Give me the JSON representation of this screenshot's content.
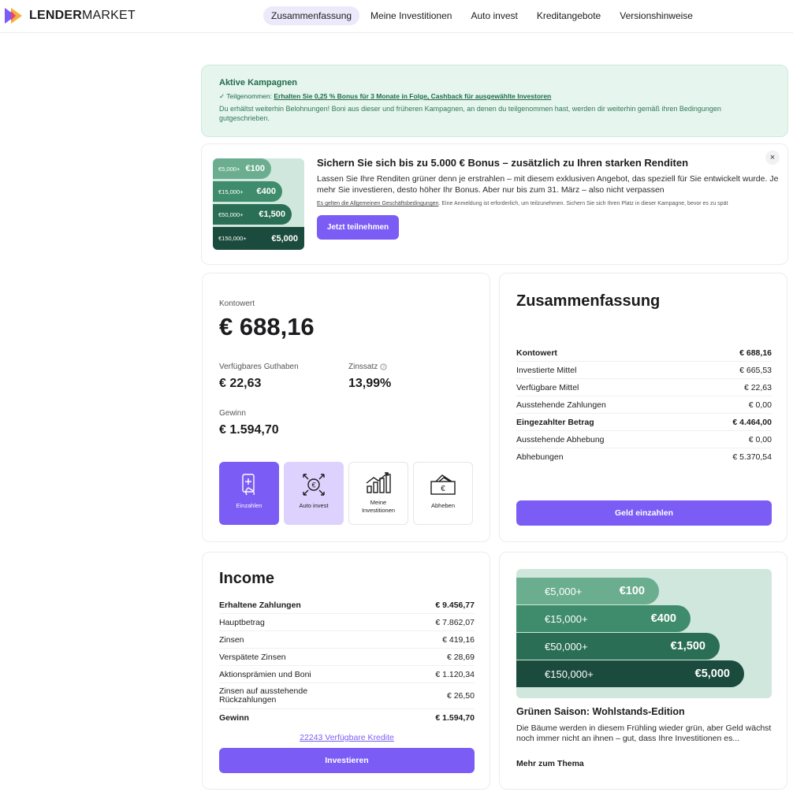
{
  "header": {
    "logo_bold": "LENDER",
    "logo_light": "MARKET",
    "nav": [
      "Zusammenfassung",
      "Meine Investitionen",
      "Auto invest",
      "Kreditangebote",
      "Versionshinweise"
    ]
  },
  "campaign": {
    "title": "Aktive Kampagnen",
    "joined_prefix": "✓ Teilgenommen: ",
    "joined_link": "Erhalten Sie 0,25 % Bonus für 3 Monate in Folge, Cashback für ausgewählte Investoren",
    "text": "Du erhältst weiterhin Belohnungen! Boni aus dieser und früheren Kampagnen, an denen du teilgenommen hast, werden dir weiterhin gemäß ihren Bedingungen gutgeschrieben."
  },
  "promo": {
    "tiers": [
      {
        "min": "€5,000+",
        "bonus": "€100"
      },
      {
        "min": "€15,000+",
        "bonus": "€400"
      },
      {
        "min": "€50,000+",
        "bonus": "€1,500"
      },
      {
        "min": "€150,000+",
        "bonus": "€5,000"
      }
    ],
    "title": "Sichern Sie sich bis zu 5.000 € Bonus – zusätzlich zu Ihren starken Renditen",
    "description": "Lassen Sie Ihre Renditen grüner denn je erstrahlen – mit diesem exklusiven Angebot, das speziell für Sie entwickelt wurde. Je mehr Sie investieren, desto höher Ihr Bonus. Aber nur bis zum 31. März – also nicht verpassen",
    "terms_link": "Es gelten die Allgemeinen Geschäftsbedingungen",
    "terms_rest": ". Eine Anmeldung ist erforderlich, um teilzunehmen. Sichern Sie sich Ihren Platz in dieser Kampagne, bevor es zu spät",
    "button": "Jetzt teilnehmen",
    "close": "×"
  },
  "account": {
    "value_label": "Kontowert",
    "value": "€ 688,16",
    "available_label": "Verfügbares Guthaben",
    "available": "€ 22,63",
    "interest_label": "Zinssatz",
    "interest": "13,99%",
    "profit_label": "Gewinn",
    "profit": "€ 1.594,70",
    "actions": [
      {
        "label": "Einzahlen",
        "icon": "deposit-phone-icon"
      },
      {
        "label": "Auto invest",
        "icon": "auto-invest-icon"
      },
      {
        "label": "Meine Investitionen",
        "icon": "investment-chart-icon"
      },
      {
        "label": "Abheben",
        "icon": "withdraw-cash-icon"
      }
    ]
  },
  "summary": {
    "title": "Zusammenfassung",
    "rows": [
      {
        "label": "Kontowert",
        "value": "€ 688,16",
        "bold": true
      },
      {
        "label": "Investierte Mittel",
        "value": "€ 665,53",
        "bold": false
      },
      {
        "label": "Verfügbare Mittel",
        "value": "€ 22,63",
        "bold": false
      },
      {
        "label": "Ausstehende Zahlungen",
        "value": "€ 0,00",
        "bold": false
      },
      {
        "label": "Eingezahlter Betrag",
        "value": "€ 4.464,00",
        "bold": true
      },
      {
        "label": "Ausstehende Abhebung",
        "value": "€ 0,00",
        "bold": false
      },
      {
        "label": "Abhebungen",
        "value": "€ 5.370,54",
        "bold": false
      }
    ],
    "button": "Geld einzahlen"
  },
  "income": {
    "title": "Income",
    "rows": [
      {
        "label": "Erhaltene Zahlungen",
        "value": "€ 9.456,77",
        "bold": true
      },
      {
        "label": "Hauptbetrag",
        "value": "€ 7.862,07",
        "bold": false
      },
      {
        "label": "Zinsen",
        "value": "€ 419,16",
        "bold": false
      },
      {
        "label": "Verspätete Zinsen",
        "value": "€ 28,69",
        "bold": false
      },
      {
        "label": "Aktionsprämien und Boni",
        "value": "€ 1.120,34",
        "bold": false
      },
      {
        "label": "Zinsen auf ausstehende Rückzahlungen",
        "value": "€ 26,50",
        "bold": false
      },
      {
        "label": "Gewinn",
        "value": "€ 1.594,70",
        "bold": true
      }
    ],
    "credits_link": "22243 Verfügbare Kredite",
    "button": "Investieren"
  },
  "article": {
    "tiers": [
      {
        "min": "€5,000+",
        "bonus": "€100"
      },
      {
        "min": "€15,000+",
        "bonus": "€400"
      },
      {
        "min": "€50,000+",
        "bonus": "€1,500"
      },
      {
        "min": "€150,000+",
        "bonus": "€5,000"
      }
    ],
    "title": "Grünen Saison: Wohlstands-Edition",
    "text": "Die Bäume werden in diesem Frühling wieder grün, aber Geld wächst noch immer nicht an ihnen – gut, dass Ihre Investitionen es...",
    "more": "Mehr zum Thema"
  },
  "colors": {
    "accent": "#7b5cf5",
    "accent_light": "#ddd2fd",
    "tier1": "#6bae8f",
    "tier2": "#3f8c6c",
    "tier3": "#2a6e55",
    "tier4": "#1b4b3c"
  }
}
